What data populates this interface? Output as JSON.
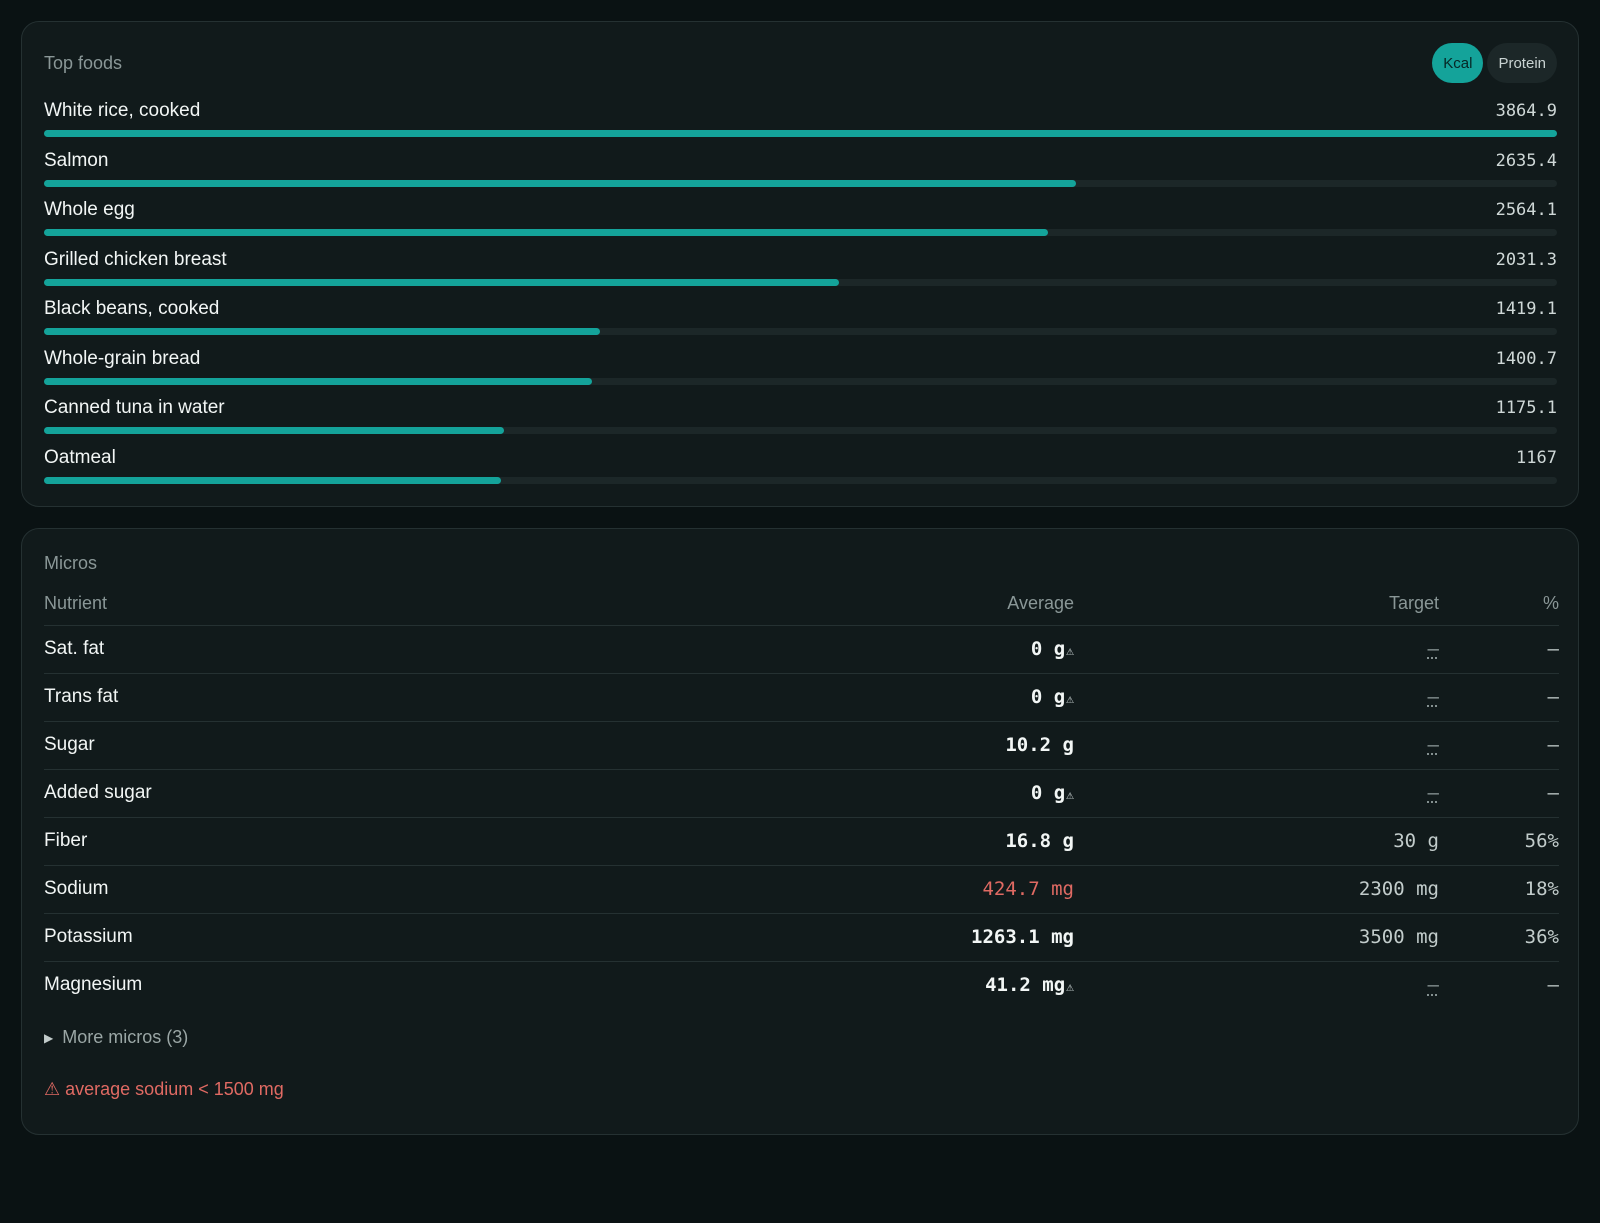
{
  "top_foods": {
    "title": "Top foods",
    "toggle": {
      "active": "Kcal",
      "inactive": "Protein"
    },
    "max_value": 3864.9,
    "items": [
      {
        "name": "White rice, cooked",
        "value": "3864.9",
        "amount": 3864.9
      },
      {
        "name": "Salmon",
        "value": "2635.4",
        "amount": 2635.4
      },
      {
        "name": "Whole egg",
        "value": "2564.1",
        "amount": 2564.1
      },
      {
        "name": "Grilled chicken breast",
        "value": "2031.3",
        "amount": 2031.3
      },
      {
        "name": "Black beans, cooked",
        "value": "1419.1",
        "amount": 1419.1
      },
      {
        "name": "Whole-grain bread",
        "value": "1400.7",
        "amount": 1400.7
      },
      {
        "name": "Canned tuna in water",
        "value": "1175.1",
        "amount": 1175.1
      },
      {
        "name": "Oatmeal",
        "value": "1167",
        "amount": 1167
      }
    ]
  },
  "micros": {
    "title": "Micros",
    "headers": {
      "nutrient": "Nutrient",
      "average": "Average",
      "target": "Target",
      "pct": "%"
    },
    "warn_icon": "⚠",
    "rows": [
      {
        "nutrient": "Sat. fat",
        "average": "0 g",
        "warn": true,
        "target": "–",
        "pct": "–"
      },
      {
        "nutrient": "Trans fat",
        "average": "0 g",
        "warn": true,
        "target": "–",
        "pct": "–"
      },
      {
        "nutrient": "Sugar",
        "average": "10.2 g",
        "warn": false,
        "target": "–",
        "pct": "–"
      },
      {
        "nutrient": "Added sugar",
        "average": "0 g",
        "warn": true,
        "target": "–",
        "pct": "–"
      },
      {
        "nutrient": "Fiber",
        "average": "16.8 g",
        "warn": false,
        "target": "30 g",
        "pct": "56%"
      },
      {
        "nutrient": "Sodium",
        "average": "424.7 mg",
        "warn": false,
        "red": true,
        "target": "2300 mg",
        "pct": "18%"
      },
      {
        "nutrient": "Potassium",
        "average": "1263.1 mg",
        "warn": false,
        "target": "3500 mg",
        "pct": "36%"
      },
      {
        "nutrient": "Magnesium",
        "average": "41.2 mg",
        "warn": true,
        "target": "–",
        "pct": "–"
      }
    ],
    "more_label": "More micros (3)",
    "sodium_warning": "⚠ average sodium < 1500 mg"
  },
  "colors": {
    "accent": "#14a39a",
    "warning_red": "#e06a63",
    "card_bg": "#111a1b",
    "page_bg": "#0a1213"
  }
}
